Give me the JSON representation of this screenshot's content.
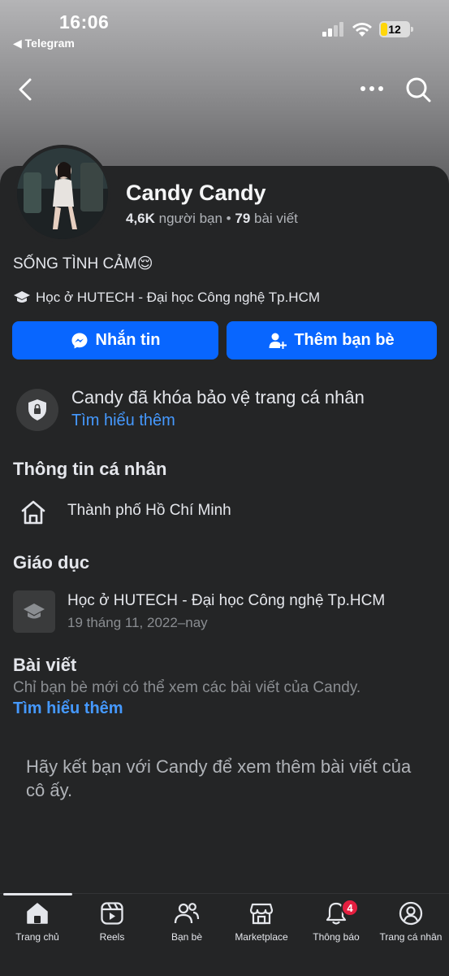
{
  "status_bar": {
    "time": "16:06",
    "back_app": "◀ Telegram",
    "battery": "12"
  },
  "profile": {
    "name": "Candy Candy",
    "friends_count": "4,6K",
    "friends_label": " người bạn • ",
    "posts_count": "79",
    "posts_label": " bài viết",
    "bio": "SỐNG TÌNH CẢM😌",
    "education_line": "Học ở HUTECH - Đại học Công nghệ Tp.HCM"
  },
  "actions": {
    "message_label": "Nhắn tin",
    "add_friend_label": "Thêm bạn bè"
  },
  "lock_notice": {
    "title": "Candy đã khóa bảo vệ trang cá nhân",
    "link": "Tìm hiểu thêm"
  },
  "personal_info": {
    "title": "Thông tin cá nhân",
    "city": "Thành phố Hồ Chí Minh"
  },
  "education": {
    "title": "Giáo dục",
    "school": "Học ở HUTECH - Đại học Công nghệ Tp.HCM",
    "date": "19 tháng 11, 2022–nay"
  },
  "posts": {
    "title": "Bài viết",
    "description": "Chỉ bạn bè mới có thể xem các bài viết của Candy.",
    "link": "Tìm hiểu thêm",
    "friend_prompt": "Hãy kết bạn với Candy để xem thêm bài viết của cô ấy."
  },
  "tabs": [
    {
      "label": "Trang chủ",
      "icon": "home-icon"
    },
    {
      "label": "Reels",
      "icon": "reels-icon"
    },
    {
      "label": "Bạn bè",
      "icon": "friends-icon"
    },
    {
      "label": "Marketplace",
      "icon": "marketplace-icon"
    },
    {
      "label": "Thông báo",
      "icon": "bell-icon",
      "badge": "4"
    },
    {
      "label": "Trang cá nhân",
      "icon": "profile-icon"
    }
  ],
  "colors": {
    "accent": "#0866ff",
    "link": "#4599ff",
    "background": "#242526",
    "badge": "#e41e3f"
  }
}
